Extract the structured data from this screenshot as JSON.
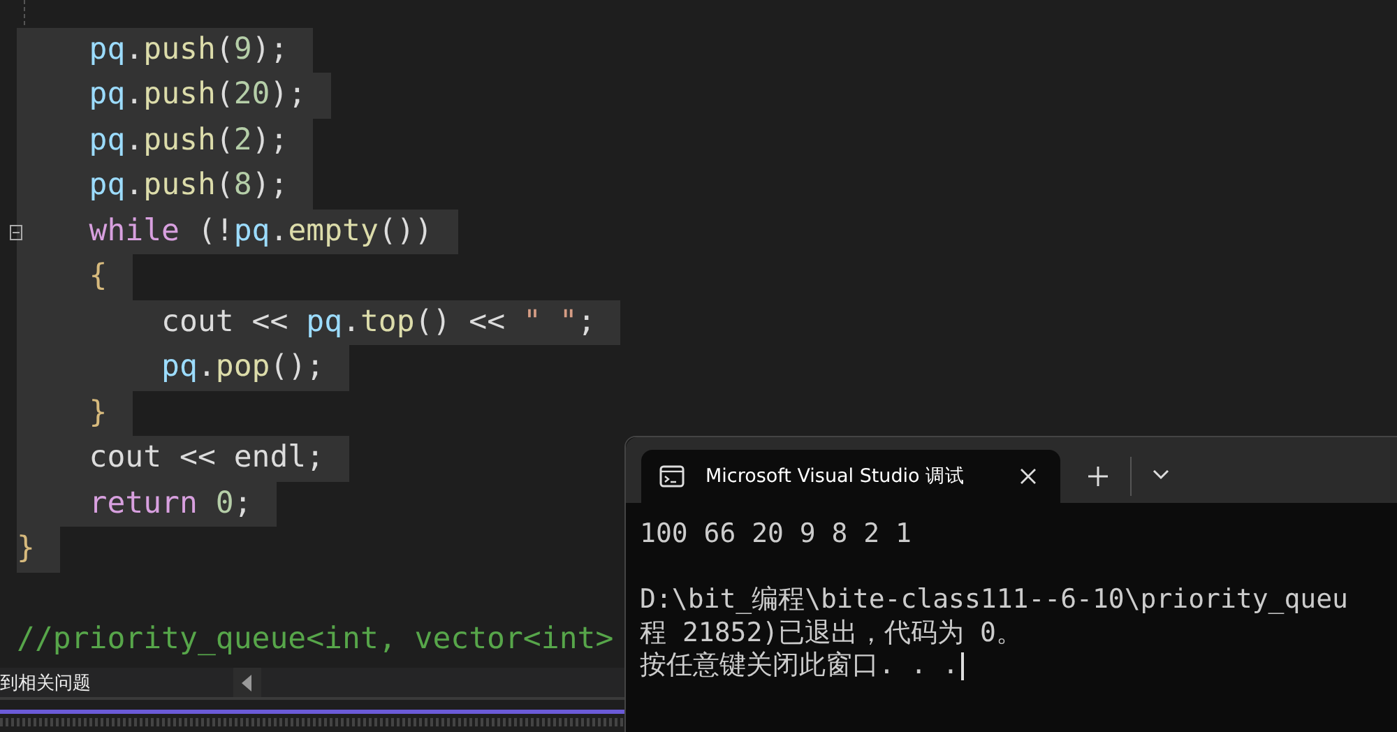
{
  "editor": {
    "lines": [
      {
        "highlighted": true,
        "collapsible": false,
        "blank_before": false,
        "tokens": [
          {
            "text": "    pq",
            "kind": "var"
          },
          {
            "text": ".",
            "kind": "plain"
          },
          {
            "text": "push",
            "kind": "fn"
          },
          {
            "text": "(",
            "kind": "plain"
          },
          {
            "text": "9",
            "kind": "num"
          },
          {
            "text": ");",
            "kind": "plain"
          }
        ]
      },
      {
        "highlighted": true,
        "collapsible": false,
        "blank_before": false,
        "tokens": [
          {
            "text": "    pq",
            "kind": "var"
          },
          {
            "text": ".",
            "kind": "plain"
          },
          {
            "text": "push",
            "kind": "fn"
          },
          {
            "text": "(",
            "kind": "plain"
          },
          {
            "text": "20",
            "kind": "num"
          },
          {
            "text": ");",
            "kind": "plain"
          }
        ]
      },
      {
        "highlighted": true,
        "collapsible": false,
        "blank_before": false,
        "tokens": [
          {
            "text": "    pq",
            "kind": "var"
          },
          {
            "text": ".",
            "kind": "plain"
          },
          {
            "text": "push",
            "kind": "fn"
          },
          {
            "text": "(",
            "kind": "plain"
          },
          {
            "text": "2",
            "kind": "num"
          },
          {
            "text": ");",
            "kind": "plain"
          }
        ]
      },
      {
        "highlighted": true,
        "collapsible": false,
        "blank_before": false,
        "tokens": [
          {
            "text": "    pq",
            "kind": "var"
          },
          {
            "text": ".",
            "kind": "plain"
          },
          {
            "text": "push",
            "kind": "fn"
          },
          {
            "text": "(",
            "kind": "plain"
          },
          {
            "text": "8",
            "kind": "num"
          },
          {
            "text": ");",
            "kind": "plain"
          }
        ]
      },
      {
        "highlighted": true,
        "collapsible": true,
        "blank_before": false,
        "tokens": [
          {
            "text": "    while",
            "kind": "kw"
          },
          {
            "text": " (!",
            "kind": "plain"
          },
          {
            "text": "pq",
            "kind": "var"
          },
          {
            "text": ".",
            "kind": "plain"
          },
          {
            "text": "empty",
            "kind": "fn"
          },
          {
            "text": "())",
            "kind": "plain"
          }
        ]
      },
      {
        "highlighted": true,
        "collapsible": false,
        "blank_before": false,
        "tokens": [
          {
            "text": "    {",
            "kind": "brace"
          }
        ]
      },
      {
        "highlighted": true,
        "collapsible": false,
        "blank_before": false,
        "tokens": [
          {
            "text": "        cout",
            "kind": "plain"
          },
          {
            "text": " << ",
            "kind": "plain"
          },
          {
            "text": "pq",
            "kind": "var"
          },
          {
            "text": ".",
            "kind": "plain"
          },
          {
            "text": "top",
            "kind": "fn"
          },
          {
            "text": "() << ",
            "kind": "plain"
          },
          {
            "text": "\" \"",
            "kind": "str"
          },
          {
            "text": ";",
            "kind": "plain"
          }
        ]
      },
      {
        "highlighted": true,
        "collapsible": false,
        "blank_before": false,
        "tokens": [
          {
            "text": "        pq",
            "kind": "var"
          },
          {
            "text": ".",
            "kind": "plain"
          },
          {
            "text": "pop",
            "kind": "fn"
          },
          {
            "text": "();",
            "kind": "plain"
          }
        ]
      },
      {
        "highlighted": true,
        "collapsible": false,
        "blank_before": false,
        "tokens": [
          {
            "text": "    }",
            "kind": "brace"
          }
        ]
      },
      {
        "highlighted": true,
        "collapsible": false,
        "blank_before": false,
        "tokens": [
          {
            "text": "    cout",
            "kind": "plain"
          },
          {
            "text": " << ",
            "kind": "plain"
          },
          {
            "text": "endl",
            "kind": "plain"
          },
          {
            "text": ";",
            "kind": "plain"
          }
        ]
      },
      {
        "highlighted": true,
        "collapsible": false,
        "blank_before": false,
        "tokens": [
          {
            "text": "    return",
            "kind": "kw"
          },
          {
            "text": " 0",
            "kind": "num"
          },
          {
            "text": ";",
            "kind": "plain"
          }
        ]
      },
      {
        "highlighted": true,
        "collapsible": false,
        "blank_before": false,
        "tokens": [
          {
            "text": "}",
            "kind": "brace"
          }
        ]
      },
      {
        "highlighted": false,
        "collapsible": false,
        "blank_before": true,
        "tokens": [
          {
            "text": "//priority_queue<int, vector<int>",
            "kind": "comment"
          }
        ]
      }
    ]
  },
  "status_bar": {
    "message": "到相关问题"
  },
  "terminal": {
    "tab": {
      "title": "Microsoft Visual Studio 调试",
      "selected": true
    },
    "output": [
      {
        "kind": "text",
        "text": "100 66 20 9 8 2 1"
      },
      {
        "kind": "blank"
      },
      {
        "kind": "text",
        "text": "D:\\bit_编程\\bite-class111--6-10\\priority_queu"
      },
      {
        "kind": "text",
        "text": "程 21852)已退出，代码为 0。"
      },
      {
        "kind": "text",
        "text": "按任意键关闭此窗口. . ."
      }
    ]
  }
}
